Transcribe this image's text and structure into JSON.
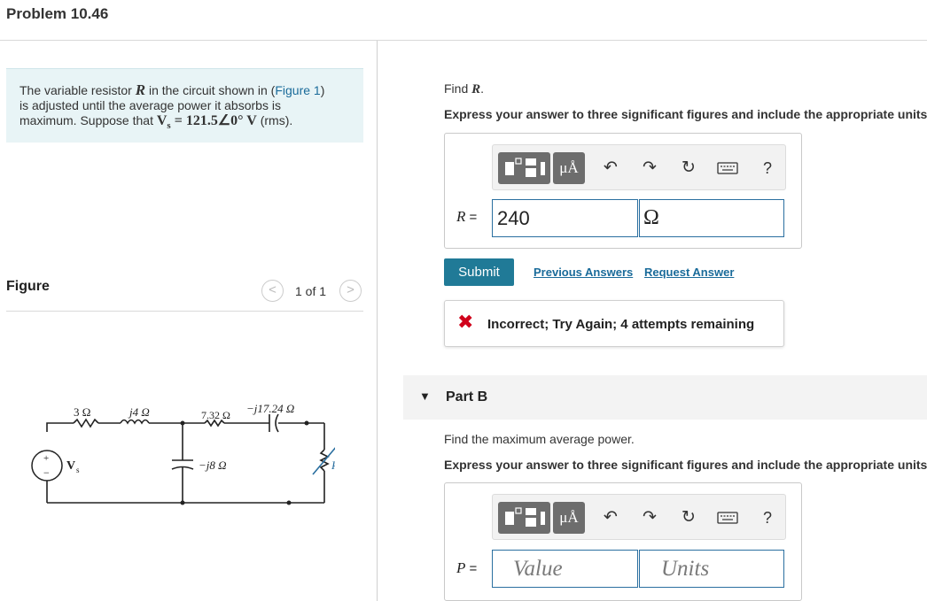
{
  "header": {
    "title": "Problem 10.46"
  },
  "problem": {
    "text_1": "The variable resistor ",
    "var_r": "R",
    "text_2": " in the circuit shown in (",
    "figure_link": "Figure 1",
    "text_3": ")",
    "text_4": "is adjusted until the average power it absorbs is",
    "text_5": "maximum. Suppose that ",
    "vs_expr": "V",
    "vs_sub": "s",
    "vs_value": " = 121.5∠0° V",
    "text_6": " (rms)."
  },
  "figure": {
    "heading": "Figure",
    "counter": "1 of 1",
    "prev_glyph": "<",
    "next_glyph": ">",
    "circuit": {
      "r1": "3 Ω",
      "l1": "j4 Ω",
      "r2": "7.32 Ω",
      "c1": "−j17.24 Ω",
      "c2": "−j8 Ω",
      "source": "V",
      "source_sub": "s",
      "load": "R",
      "plus": "+",
      "minus": "−"
    }
  },
  "part_a": {
    "find_prefix": "Find ",
    "find_var": "R",
    "find_suffix": ".",
    "instruction": "Express your answer to three significant figures and include the appropriate units.",
    "label_var": "R",
    "label_eq": " = ",
    "value": "240",
    "units": "Ω",
    "submit_label": "Submit",
    "previous_answers": "Previous Answers",
    "request_answer": "Request Answer",
    "feedback_icon": "✖",
    "feedback": "Incorrect; Try Again; 4 attempts remaining"
  },
  "part_b": {
    "toggle_glyph": "▼",
    "title": "Part B",
    "find": "Find the maximum average power.",
    "instruction": "Express your answer to three significant figures and include the appropriate units.",
    "label_var": "P",
    "label_eq": " = ",
    "value_placeholder": "Value",
    "units_placeholder": "Units"
  },
  "toolbar": {
    "units_label": "μÅ",
    "undo_icon": "↶",
    "redo_icon": "↷",
    "reset_icon": "↻",
    "help_label": "?"
  },
  "colors": {
    "accent": "#207a97",
    "link": "#1a6b9a",
    "problem_bg": "#e8f4f6",
    "error": "#d0021b"
  }
}
